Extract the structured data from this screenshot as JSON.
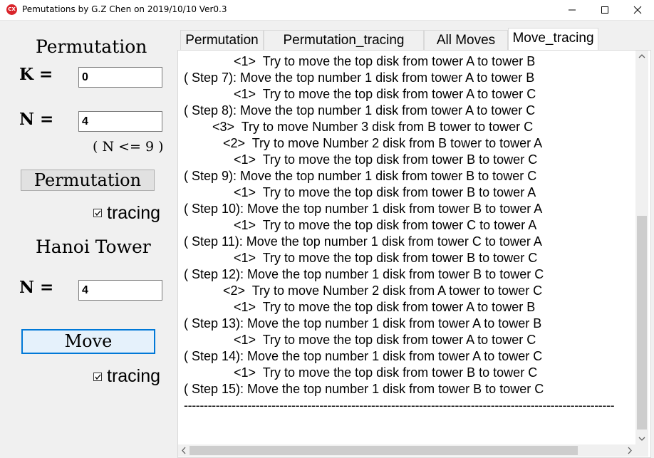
{
  "window": {
    "title": "Pemutations by G.Z Chen on 2019/10/10 Ver0.3",
    "icon_text": "CX"
  },
  "left": {
    "permutation_heading": "Permutation",
    "k_label": "K =",
    "k_value": "0",
    "n_label": "N =",
    "n_value": "4",
    "n_hint": "( N <= 9 )",
    "permutation_button": "Permutation",
    "tracing1_label": "tracing",
    "tracing1_checked": true,
    "hanoi_heading": "Hanoi Tower",
    "hanoi_n_label": "N =",
    "hanoi_n_value": "4",
    "move_button": "Move",
    "tracing2_label": "tracing",
    "tracing2_checked": true
  },
  "tabs": [
    {
      "label": "Permutation",
      "active": false
    },
    {
      "label": "Permutation_tracing",
      "active": false
    },
    {
      "label": "All Moves",
      "active": false
    },
    {
      "label": "Move_tracing",
      "active": true
    }
  ],
  "output_lines": [
    "              <1>  Try to move the top disk from tower A to tower B",
    "( Step 7): Move the top number 1 disk from tower A to tower B",
    "              <1>  Try to move the top disk from tower A to tower C",
    "( Step 8): Move the top number 1 disk from tower A to tower C",
    "        <3>  Try to move Number 3 disk from B tower to tower C",
    "           <2>  Try to move Number 2 disk from B tower to tower A",
    "              <1>  Try to move the top disk from tower B to tower C",
    "( Step 9): Move the top number 1 disk from tower B to tower C",
    "              <1>  Try to move the top disk from tower B to tower A",
    "( Step 10): Move the top number 1 disk from tower B to tower A",
    "              <1>  Try to move the top disk from tower C to tower A",
    "( Step 11): Move the top number 1 disk from tower C to tower A",
    "              <1>  Try to move the top disk from tower B to tower C",
    "( Step 12): Move the top number 1 disk from tower B to tower C",
    "           <2>  Try to move Number 2 disk from A tower to tower C",
    "              <1>  Try to move the top disk from tower A to tower B",
    "( Step 13): Move the top number 1 disk from tower A to tower B",
    "              <1>  Try to move the top disk from tower A to tower C",
    "( Step 14): Move the top number 1 disk from tower A to tower C",
    "              <1>  Try to move the top disk from tower B to tower C",
    "( Step 15): Move the top number 1 disk from tower B to tower C",
    "------------------------------------------------------------------------------------------------------------"
  ],
  "colors": {
    "accent": "#0078d7",
    "app_icon": "#d9242b"
  }
}
